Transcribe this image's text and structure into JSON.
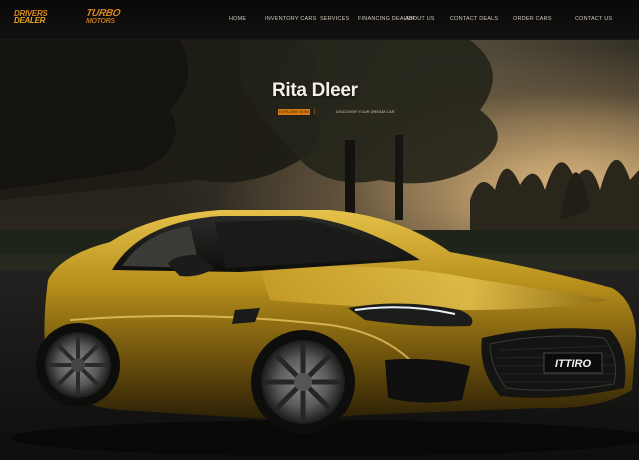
{
  "logos": {
    "primary": {
      "line1": "DRIVERS",
      "line2": "DEALER"
    },
    "secondary": {
      "line1": "TURBO",
      "line2": "MOTORS"
    }
  },
  "nav": {
    "items": [
      {
        "label": "HOME"
      },
      {
        "label": "INVENTORY CARS"
      },
      {
        "label": "SERVICES"
      },
      {
        "label": "FINANCING DEALER"
      },
      {
        "label": "ABOUT US"
      },
      {
        "label": "CONTACT DEALS"
      },
      {
        "label": "ORDER CARS"
      },
      {
        "label": "CONTACT US"
      }
    ]
  },
  "hero": {
    "title": "Rita Dleer",
    "badge": "EXPLORE NOW",
    "separator": "|",
    "tagline": "DISCOVER YOUR DREAM CAR",
    "plate": "ITTIRO"
  },
  "colors": {
    "accent": "#d47a10",
    "car_body": "#b8901c",
    "background": "#0b0a09"
  }
}
